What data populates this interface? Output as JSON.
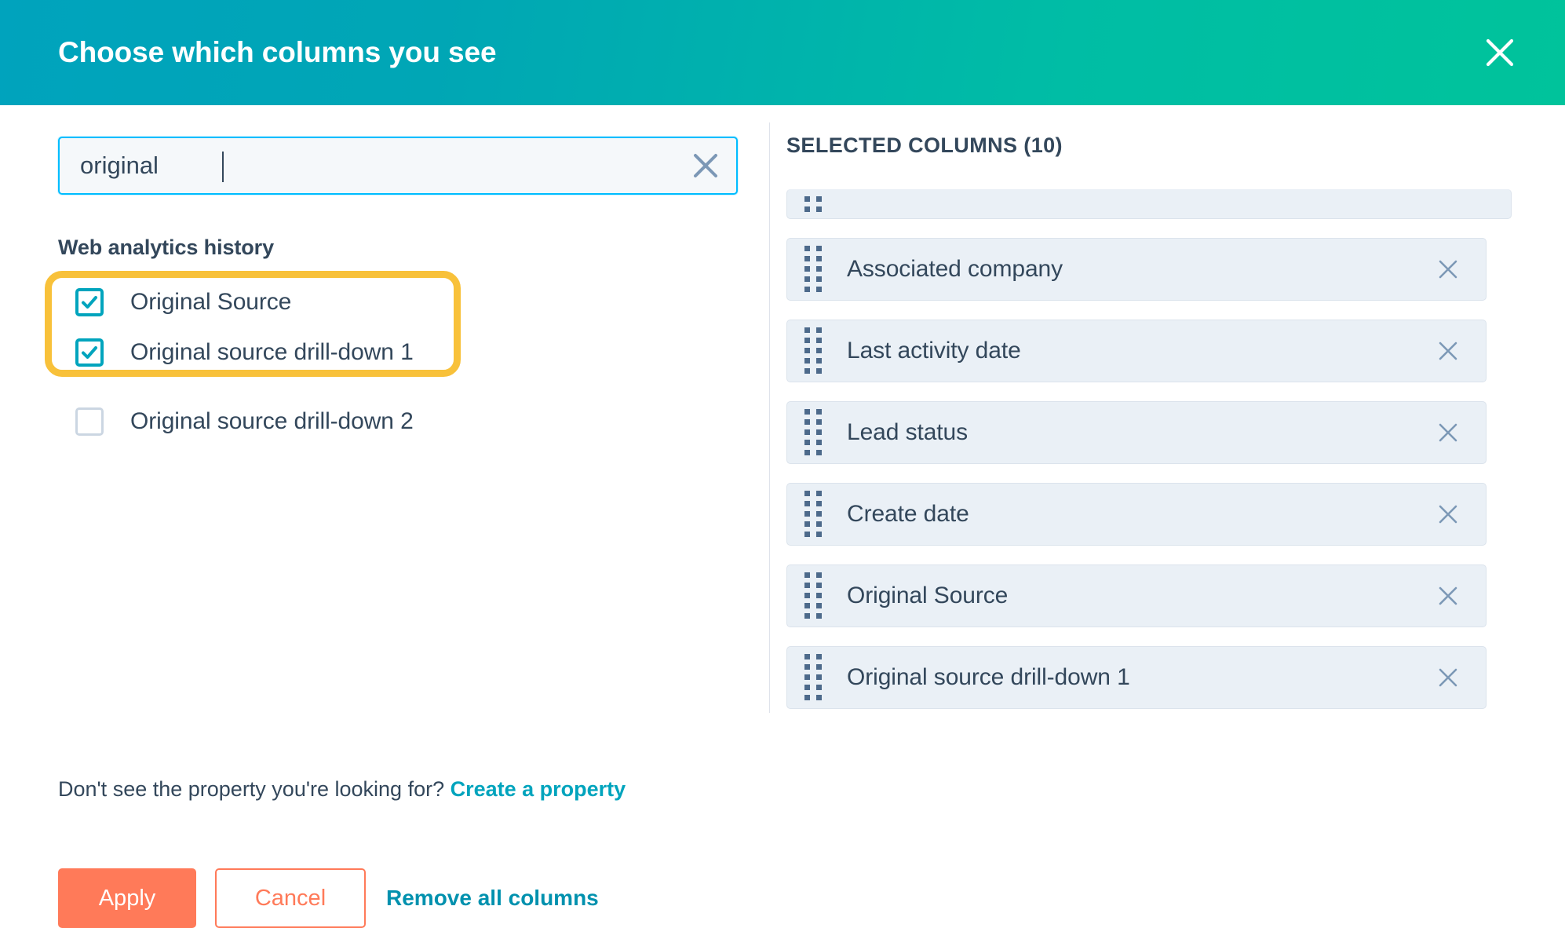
{
  "header": {
    "title": "Choose which columns you see",
    "close_label": "close-icon",
    "gradient_from": "#00a3bd",
    "gradient_to": "#00c39b"
  },
  "search": {
    "value": "original",
    "placeholder": "Search columns",
    "clear_label": "clear-search-icon",
    "border_color": "#00bdff"
  },
  "property_group": {
    "label": "Web analytics history",
    "highlight_color": "#f8c13a",
    "checkbox_accent": "#00a4bd",
    "options": [
      {
        "label": "Original Source",
        "checked": true,
        "highlighted": true
      },
      {
        "label": "Original source drill-down 1",
        "checked": true,
        "highlighted": true
      },
      {
        "label": "Original source drill-down 2",
        "checked": false,
        "highlighted": false
      }
    ]
  },
  "footer_note": {
    "text": "Don't see the property you're looking for?",
    "link_label": "Create a property",
    "link_color": "#00a4bd"
  },
  "actions": {
    "apply_label": "Apply",
    "cancel_label": "Cancel",
    "remove_all_label": "Remove all columns",
    "apply_color": "#ff7a59",
    "link_color": "#0091ae"
  },
  "selected_panel": {
    "title": "SELECTED COLUMNS (10)",
    "count": 10,
    "rows": [
      {
        "label": "",
        "clipped": true
      },
      {
        "label": "Associated company",
        "clipped": false
      },
      {
        "label": "Last activity date",
        "clipped": false
      },
      {
        "label": "Lead status",
        "clipped": false
      },
      {
        "label": "Create date",
        "clipped": false
      },
      {
        "label": "Original Source",
        "clipped": false
      },
      {
        "label": "Original source drill-down 1",
        "clipped": false
      }
    ]
  }
}
